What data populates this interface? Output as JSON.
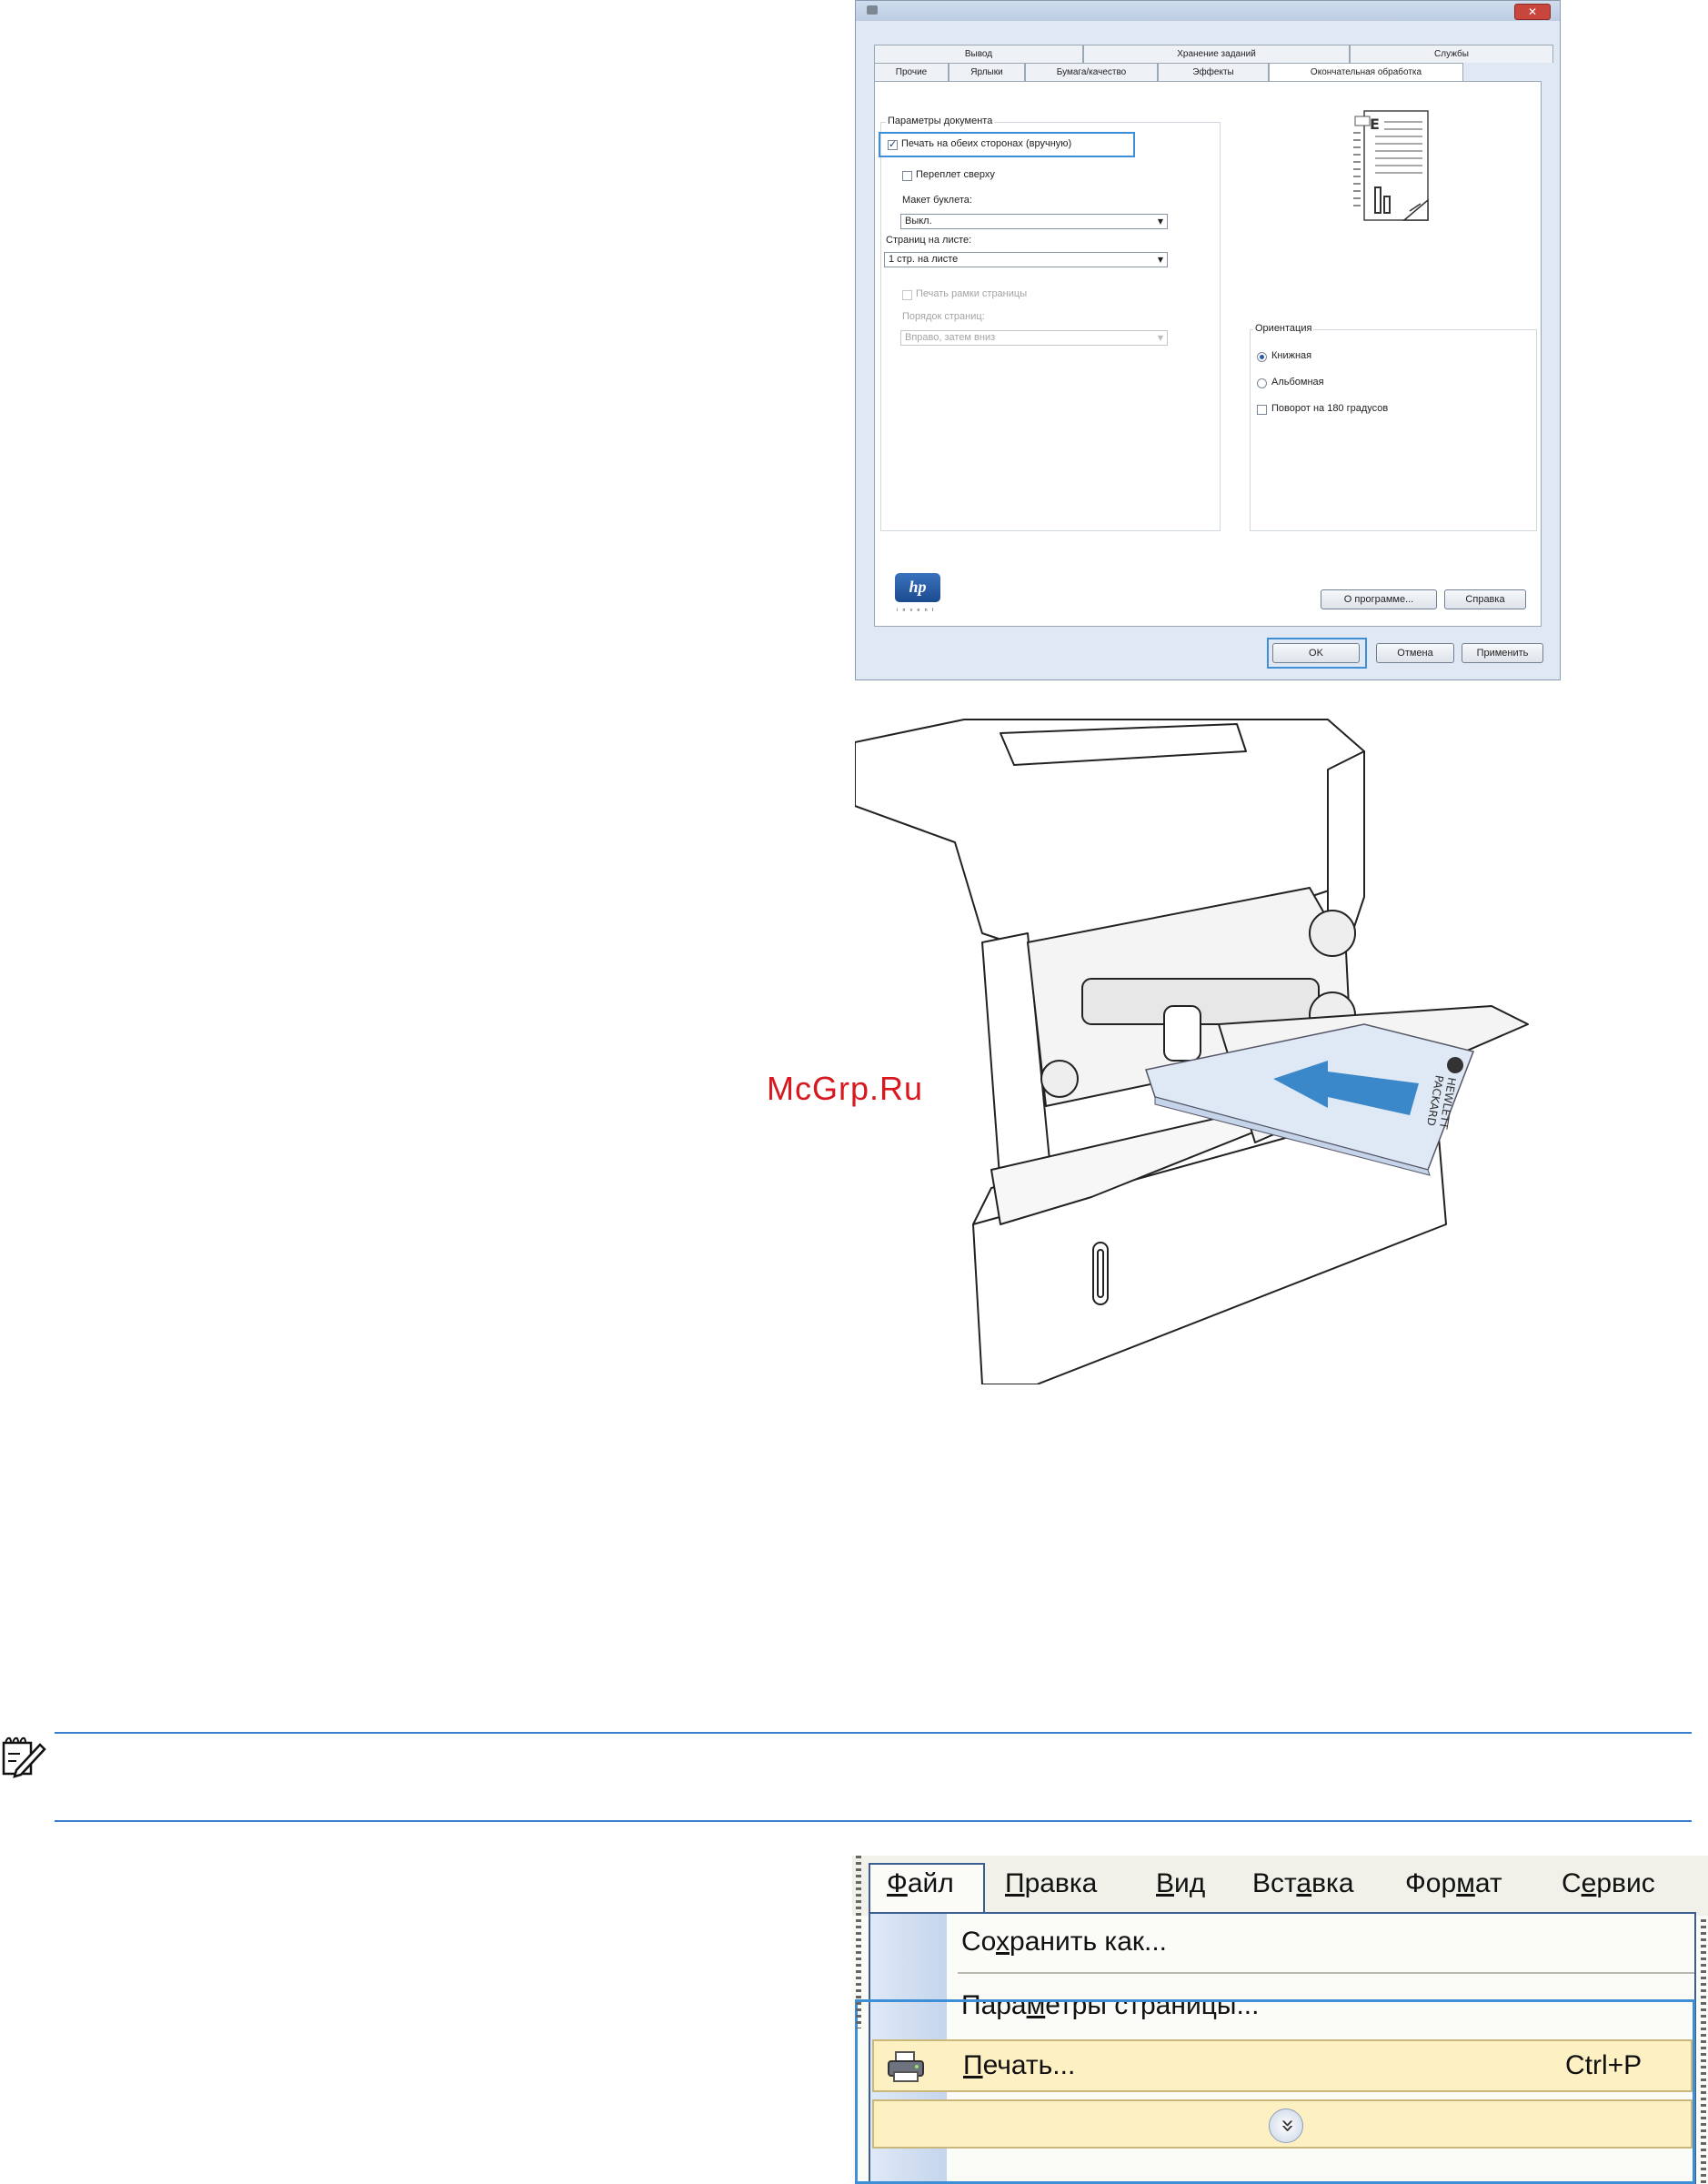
{
  "print_dialog": {
    "tabs_row1": [
      "Вывод",
      "Хранение заданий",
      "Службы"
    ],
    "tabs_row2": [
      "Прочие",
      "Ярлыки",
      "Бумага/качество",
      "Эффекты",
      "Окончательная обработка"
    ],
    "document_options": {
      "group_label": "Параметры документа",
      "duplex_checkbox": "Печать на обеих сторонах (вручную)",
      "flip_checkbox": "Переплет сверху",
      "booklet_label": "Макет буклета:",
      "booklet_value": "Выкл.",
      "pages_per_sheet_label": "Страниц на листе:",
      "pages_per_sheet_value": "1 стр. на листе",
      "print_borders_checkbox": "Печать рамки страницы",
      "page_order_label": "Порядок страниц:",
      "page_order_value": "Вправо, затем вниз"
    },
    "orientation": {
      "group_label": "Ориентация",
      "portrait": "Книжная",
      "landscape": "Альбомная",
      "rotate": "Поворот на 180 градусов"
    },
    "logo_tagline": "i n v e n t",
    "buttons": {
      "about": "О программе...",
      "help": "Справка",
      "ok": "OK",
      "cancel": "Отмена",
      "apply": "Применить"
    }
  },
  "printer_illustration": {
    "paper_brand_line1": "HEWLETT",
    "paper_brand_line2": "PACKARD"
  },
  "watermark": "McGrp.Ru",
  "menu": {
    "menubar": [
      {
        "pre": "",
        "u": "Ф",
        "post": "айл"
      },
      {
        "pre": "",
        "u": "П",
        "post": "равка"
      },
      {
        "pre": "",
        "u": "В",
        "post": "ид"
      },
      {
        "pre": "Вст",
        "u": "а",
        "post": "вка"
      },
      {
        "pre": "Фор",
        "u": "м",
        "post": "ат"
      },
      {
        "pre": "С",
        "u": "е",
        "post": "рвис"
      }
    ],
    "items": {
      "save_as": {
        "pre": "Со",
        "u": "х",
        "post": "ранить как..."
      },
      "page_setup": {
        "pre": "Пара",
        "u": "м",
        "post": "етры страницы..."
      },
      "print": {
        "pre": "",
        "u": "П",
        "post": "ечать..."
      },
      "print_shortcut": "Ctrl+P",
      "expand_glyph": "»"
    }
  }
}
